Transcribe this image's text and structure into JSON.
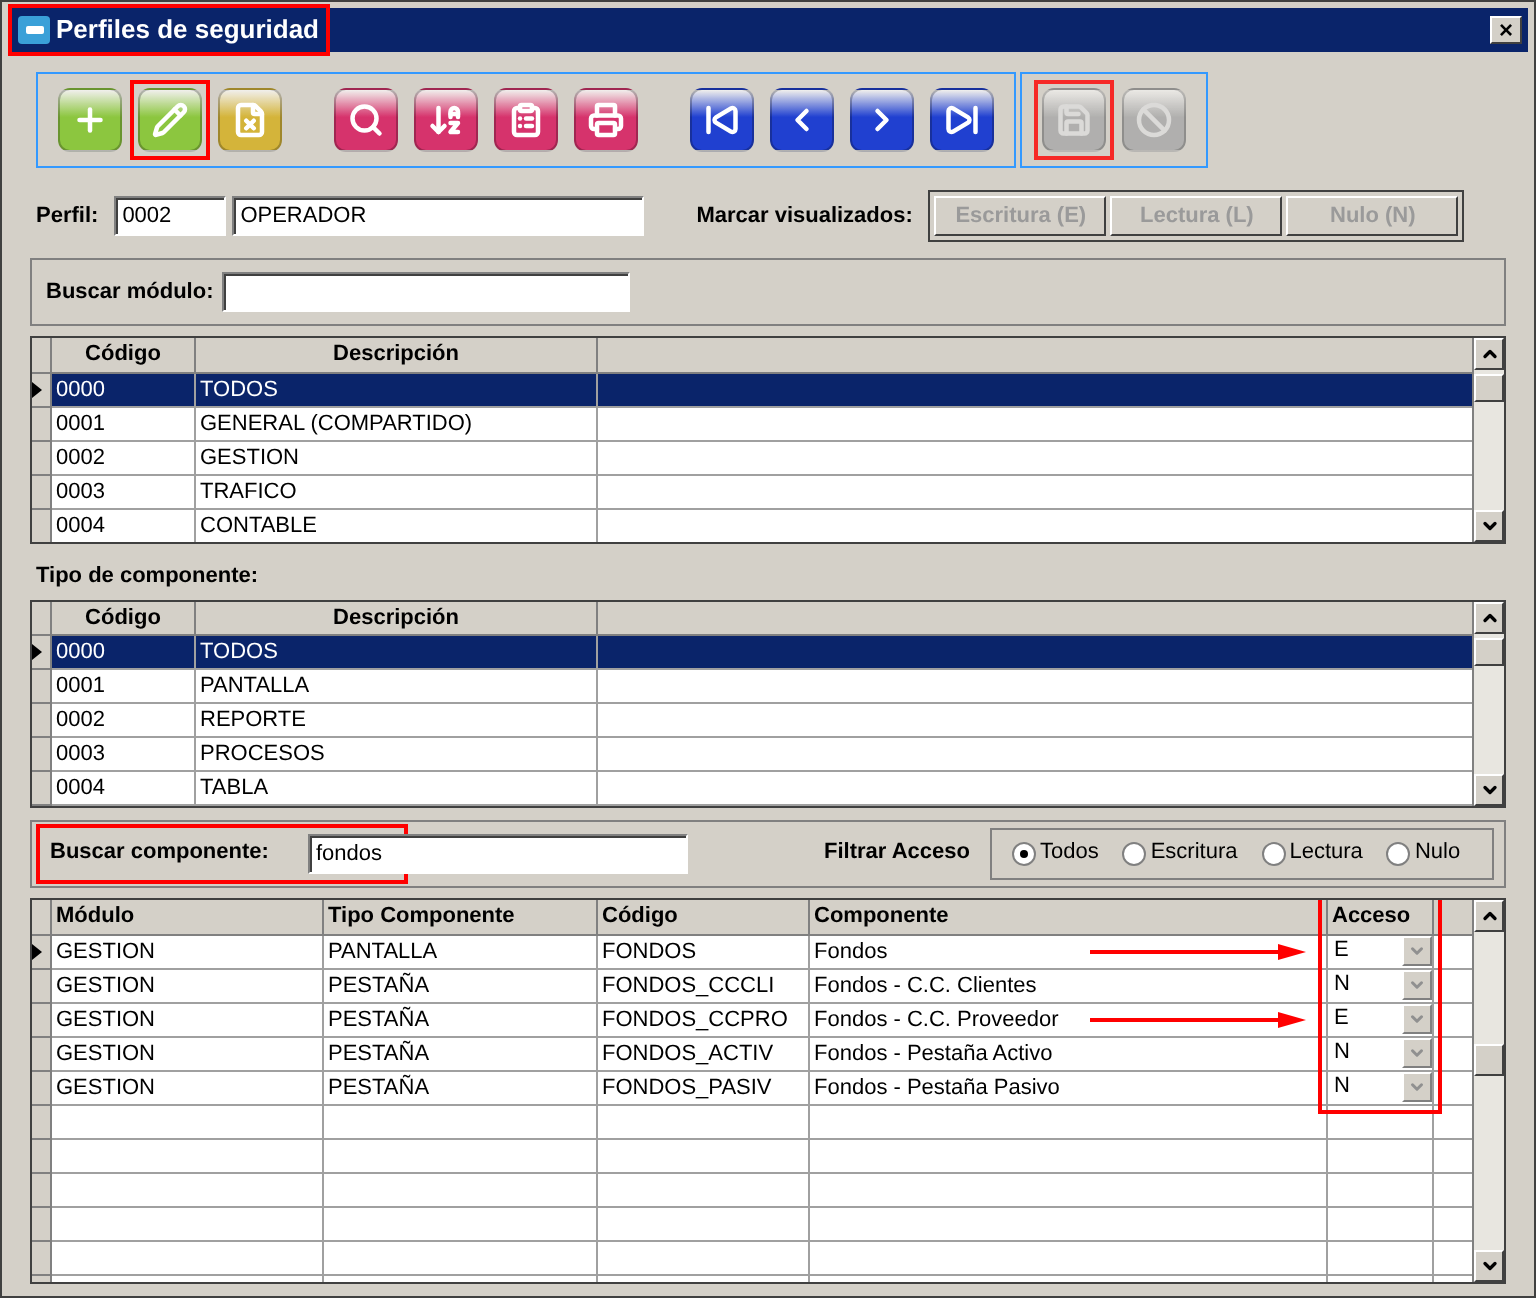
{
  "window": {
    "title": "Perfiles de seguridad",
    "title_highlighted": true,
    "close": "×"
  },
  "toolbar": [
    {
      "color": "#8cc63f",
      "disabled": false,
      "highlighted": false
    },
    {
      "color": "#8cc63f",
      "disabled": false,
      "highlighted": true
    },
    {
      "color": "#d4b43a",
      "disabled": false,
      "highlighted": false
    },
    {
      "color": "#d6336c",
      "disabled": false,
      "highlighted": false
    },
    {
      "color": "#d6336c",
      "disabled": false,
      "highlighted": false
    },
    {
      "color": "#d6336c",
      "disabled": false,
      "highlighted": false
    },
    {
      "color": "#d6336c",
      "disabled": false,
      "highlighted": false
    },
    {
      "color": "#2040d0",
      "disabled": false,
      "highlighted": false
    },
    {
      "color": "#2040d0",
      "disabled": false,
      "highlighted": false
    },
    {
      "color": "#2040d0",
      "disabled": false,
      "highlighted": false
    },
    {
      "color": "#2040d0",
      "disabled": false,
      "highlighted": false
    },
    {
      "color": "#a8a8a8",
      "disabled": true,
      "highlighted": true
    },
    {
      "color": "#a8a8a8",
      "disabled": true,
      "highlighted": false
    }
  ],
  "perfil": {
    "label": "Perfil:",
    "code": "0002",
    "name": "OPERADOR"
  },
  "marcar": {
    "label": "Marcar visualizados:",
    "buttons": [
      {
        "label": "Escritura (E)",
        "disabled": true
      },
      {
        "label": "Lectura (L)",
        "disabled": true
      },
      {
        "label": "Nulo (N)",
        "disabled": true
      }
    ]
  },
  "buscar_modulo": {
    "label": "Buscar módulo:"
  },
  "modulos": {
    "columns": [
      "Código",
      "Descripción"
    ],
    "rows": [
      {
        "code": "0000",
        "desc": "TODOS",
        "selected": true
      },
      {
        "code": "0001",
        "desc": "GENERAL (COMPARTIDO)",
        "selected": false
      },
      {
        "code": "0002",
        "desc": "GESTION",
        "selected": false
      },
      {
        "code": "0003",
        "desc": "TRAFICO",
        "selected": false
      },
      {
        "code": "0004",
        "desc": "CONTABLE",
        "selected": false
      }
    ]
  },
  "tipo_label": "Tipo de componente:",
  "tipos": {
    "columns": [
      "Código",
      "Descripción"
    ],
    "rows": [
      {
        "code": "0000",
        "desc": "TODOS",
        "selected": true
      },
      {
        "code": "0001",
        "desc": "PANTALLA",
        "selected": false
      },
      {
        "code": "0002",
        "desc": "REPORTE",
        "selected": false
      },
      {
        "code": "0003",
        "desc": "PROCESOS",
        "selected": false
      },
      {
        "code": "0004",
        "desc": "TABLA",
        "selected": false
      }
    ]
  },
  "buscar_componente": {
    "label": "Buscar componente:",
    "value": "fondos",
    "highlighted": true
  },
  "filtrar": {
    "label": "Filtrar Acceso",
    "options": [
      {
        "label": "Todos",
        "selected": true
      },
      {
        "label": "Escritura",
        "selected": false
      },
      {
        "label": "Lectura",
        "selected": false
      },
      {
        "label": "Nulo",
        "selected": false
      }
    ]
  },
  "componentes": {
    "columns": [
      "Módulo",
      "Tipo Componente",
      "Código",
      "Componente",
      "Acceso"
    ],
    "acceso_highlighted": true,
    "rows": [
      {
        "modulo": "GESTION",
        "tipo": "PANTALLA",
        "codigo": "FONDOS",
        "componente": "Fondos",
        "acceso": "E",
        "current": true,
        "arrow": true
      },
      {
        "modulo": "GESTION",
        "tipo": "PESTAÑA",
        "codigo": "FONDOS_CCCLI",
        "componente": "Fondos - C.C. Clientes",
        "acceso": "N",
        "current": false,
        "arrow": false
      },
      {
        "modulo": "GESTION",
        "tipo": "PESTAÑA",
        "codigo": "FONDOS_CCPRO",
        "componente": "Fondos - C.C. Proveedor",
        "acceso": "E",
        "current": false,
        "arrow": true
      },
      {
        "modulo": "GESTION",
        "tipo": "PESTAÑA",
        "codigo": "FONDOS_ACTIV",
        "componente": "Fondos - Pestaña Activo",
        "acceso": "N",
        "current": false,
        "arrow": false
      },
      {
        "modulo": "GESTION",
        "tipo": "PESTAÑA",
        "codigo": "FONDOS_PASIV",
        "componente": "Fondos - Pestaña Pasivo",
        "acceso": "N",
        "current": false,
        "arrow": false
      }
    ]
  }
}
